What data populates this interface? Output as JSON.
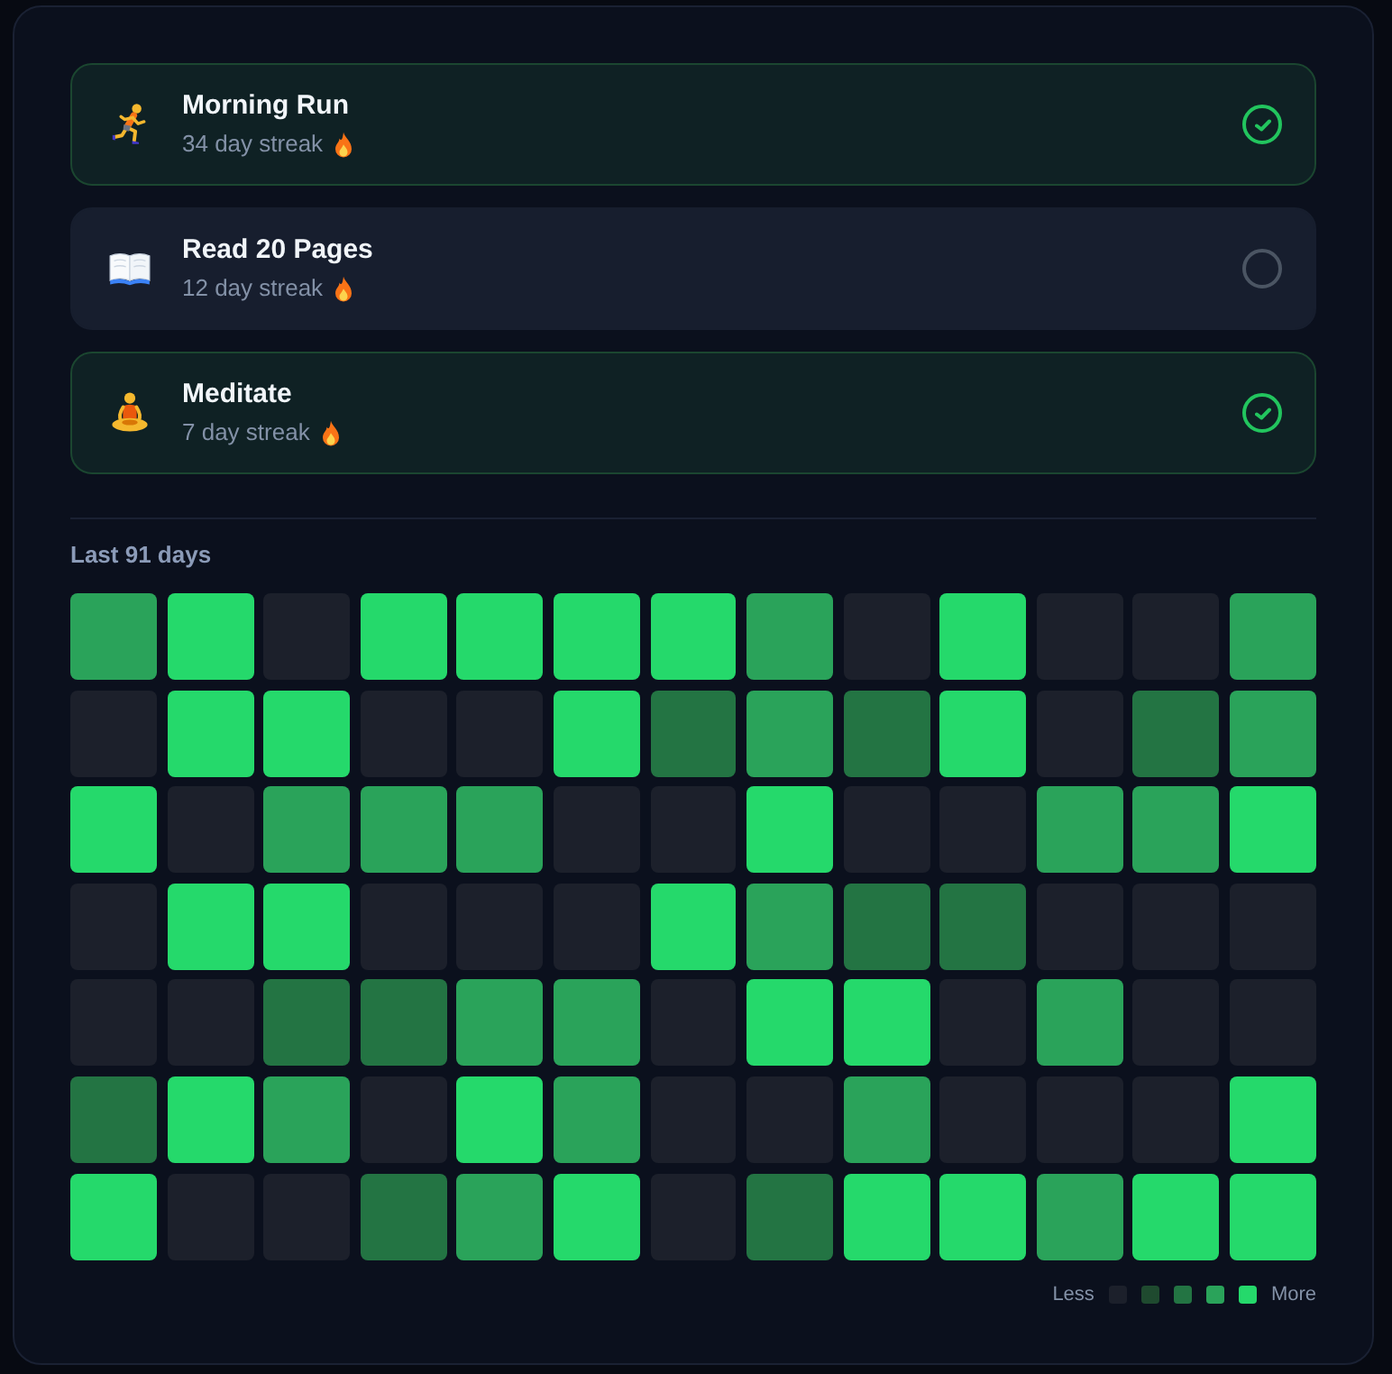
{
  "habits": [
    {
      "kind": "run",
      "name": "Morning Run",
      "streak": "34 day streak",
      "checked": true
    },
    {
      "kind": "read",
      "name": "Read 20 Pages",
      "streak": "12 day streak",
      "checked": false
    },
    {
      "kind": "meditate",
      "name": "Meditate",
      "streak": "7 day streak",
      "checked": true
    }
  ],
  "history": {
    "title": "Last 91 days",
    "cells": [
      {
        "color": "#2aa35a"
      },
      {
        "color": "#25d96b"
      },
      {
        "color": "#1c202b"
      },
      {
        "color": "#25d96b"
      },
      {
        "color": "#25d96b"
      },
      {
        "color": "#25d96b"
      },
      {
        "color": "#25d96b"
      },
      {
        "color": "#2aa35a"
      },
      {
        "color": "#1c202b"
      },
      {
        "color": "#25d96b"
      },
      {
        "color": "#1c202b"
      },
      {
        "color": "#1c202b"
      },
      {
        "color": "#2aa35a"
      },
      {
        "color": "#1c202b"
      },
      {
        "color": "#25d96b"
      },
      {
        "color": "#25d96b"
      },
      {
        "color": "#1c202b"
      },
      {
        "color": "#1c202b"
      },
      {
        "color": "#25d96b"
      },
      {
        "color": "#237443"
      },
      {
        "color": "#2aa35a"
      },
      {
        "color": "#237443"
      },
      {
        "color": "#25d96b"
      },
      {
        "color": "#1c202b"
      },
      {
        "color": "#237443"
      },
      {
        "color": "#2aa35a"
      },
      {
        "color": "#25d96b"
      },
      {
        "color": "#1c202b"
      },
      {
        "color": "#2aa35a"
      },
      {
        "color": "#2aa35a"
      },
      {
        "color": "#2aa35a"
      },
      {
        "color": "#1c202b"
      },
      {
        "color": "#1c202b"
      },
      {
        "color": "#25d96b"
      },
      {
        "color": "#1c202b"
      },
      {
        "color": "#1c202b"
      },
      {
        "color": "#2aa35a"
      },
      {
        "color": "#2aa35a"
      },
      {
        "color": "#25d96b"
      },
      {
        "color": "#1c202b"
      },
      {
        "color": "#25d96b"
      },
      {
        "color": "#25d96b"
      },
      {
        "color": "#1c202b"
      },
      {
        "color": "#1c202b"
      },
      {
        "color": "#1c202b"
      },
      {
        "color": "#25d96b"
      },
      {
        "color": "#2aa35a"
      },
      {
        "color": "#237443"
      },
      {
        "color": "#237443"
      },
      {
        "color": "#1c202b"
      },
      {
        "color": "#1c202b"
      },
      {
        "color": "#1c202b"
      },
      {
        "color": "#1c202b"
      },
      {
        "color": "#1c202b"
      },
      {
        "color": "#237443"
      },
      {
        "color": "#237443"
      },
      {
        "color": "#2aa35a"
      },
      {
        "color": "#2aa35a"
      },
      {
        "color": "#1c202b"
      },
      {
        "color": "#25d96b"
      },
      {
        "color": "#25d96b"
      },
      {
        "color": "#1c202b"
      },
      {
        "color": "#2aa35a"
      },
      {
        "color": "#1c202b"
      },
      {
        "color": "#1c202b"
      },
      {
        "color": "#237443"
      },
      {
        "color": "#25d96b"
      },
      {
        "color": "#2aa35a"
      },
      {
        "color": "#1c202b"
      },
      {
        "color": "#25d96b"
      },
      {
        "color": "#2aa35a"
      },
      {
        "color": "#1c202b"
      },
      {
        "color": "#1c202b"
      },
      {
        "color": "#2aa35a"
      },
      {
        "color": "#1c202b"
      },
      {
        "color": "#1c202b"
      },
      {
        "color": "#1c202b"
      },
      {
        "color": "#25d96b"
      },
      {
        "color": "#25d96b"
      },
      {
        "color": "#1c202b"
      },
      {
        "color": "#1c202b"
      },
      {
        "color": "#237443"
      },
      {
        "color": "#2aa35a"
      },
      {
        "color": "#25d96b"
      },
      {
        "color": "#1c202b"
      },
      {
        "color": "#237443"
      },
      {
        "color": "#25d96b"
      },
      {
        "color": "#25d96b"
      },
      {
        "color": "#2aa35a"
      },
      {
        "color": "#25d96b"
      },
      {
        "color": "#25d96b"
      }
    ]
  },
  "legend": {
    "less": "Less",
    "swatches": [
      {
        "color": "#1c202b"
      },
      {
        "color": "#1f4a2f"
      },
      {
        "color": "#237443"
      },
      {
        "color": "#2aa35a"
      },
      {
        "color": "#25d96b"
      }
    ],
    "more": "More"
  }
}
